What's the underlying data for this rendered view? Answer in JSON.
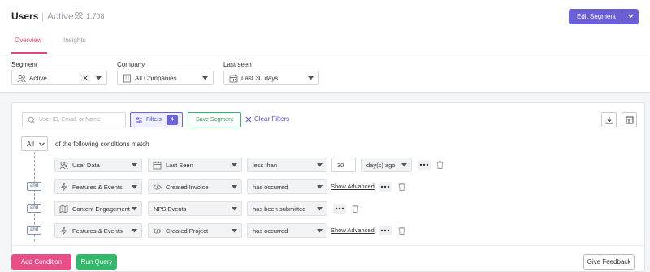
{
  "header": {
    "title": "Users",
    "status": "Active",
    "count": "1,708",
    "edit_label": "Edit Segment"
  },
  "tabs": [
    {
      "label": "Overview",
      "active": true
    },
    {
      "label": "Insights",
      "active": false
    }
  ],
  "filters": {
    "segment": {
      "label": "Segment",
      "value": "Active"
    },
    "company": {
      "label": "Company",
      "value": "All Companies"
    },
    "last_seen": {
      "label": "Last seen",
      "value": "Last 30 days"
    }
  },
  "query": {
    "search_placeholder": "User ID, Email, or Name",
    "filters_label": "Filters",
    "filters_count": "4",
    "save_label": "Save Segment",
    "clear_label": "Clear Filters",
    "match_select": "All",
    "match_text": "of the following conditions match",
    "and_label": "and",
    "conditions": [
      {
        "source": "User Data",
        "field": "Last Seen",
        "operator": "less than",
        "value": "30",
        "unit": "day(s) ago"
      },
      {
        "source": "Features & Events",
        "field": "Created Invoice",
        "operator": "has occurred",
        "advanced": "Show Advanced"
      },
      {
        "source": "Content Engagement",
        "field": "NPS Events",
        "operator": "has been submitted"
      },
      {
        "source": "Features & Events",
        "field": "Created Project",
        "operator": "has occurred",
        "advanced": "Show Advanced"
      }
    ]
  },
  "footer": {
    "add_label": "Add Condition",
    "run_label": "Run Query",
    "feedback_label": "Give Feedback"
  },
  "colors": {
    "primary": "#6b5fd8",
    "pink": "#e94e86",
    "green": "#31b86a",
    "tab_active": "#e0457b"
  }
}
